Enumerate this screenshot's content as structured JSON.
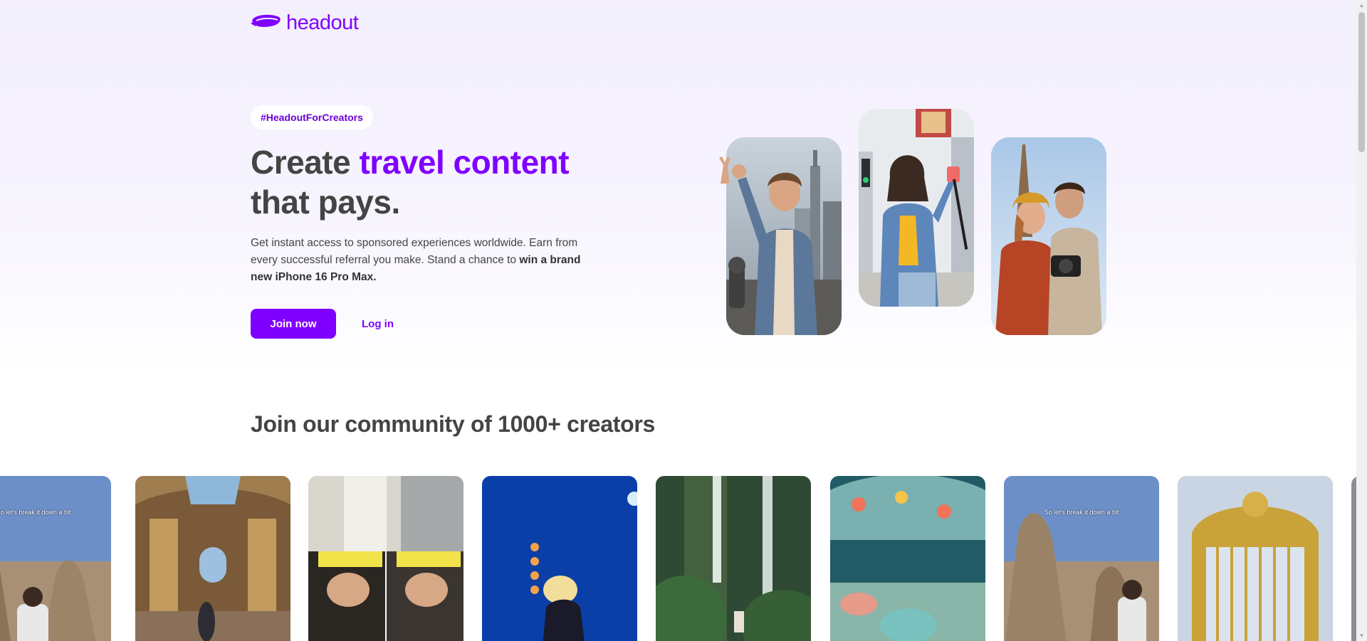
{
  "brand": {
    "name": "headout",
    "logo_icon": "headout-blimp-icon",
    "color": "#8000ff"
  },
  "hero": {
    "tag": "#HeadoutForCreators",
    "title_line1_plain": "Create ",
    "title_line1_accent": "travel content",
    "title_line2": "that pays.",
    "description_plain": "Get instant access to sponsored experiences worldwide. Earn from every successful referral you make. Stand a chance to ",
    "description_bold": "win a brand new iPhone 16 Pro Max.",
    "join_label": "Join now",
    "login_label": "Log in"
  },
  "community": {
    "title": "Join our community of 1000+ creators",
    "reels": [
      {
        "caption": "So let's break it down a bit",
        "scene": "cappadocia-rocks"
      },
      {
        "caption": "",
        "scene": "palace-hall"
      },
      {
        "caption": "",
        "scene": "skydive-split"
      },
      {
        "caption": "",
        "scene": "concert-stage"
      },
      {
        "caption": "",
        "scene": "jungle-waterfall"
      },
      {
        "caption": "",
        "scene": "teacup-ride"
      },
      {
        "caption": "So let's break it down a bit",
        "scene": "cappadocia-rocks"
      },
      {
        "caption": "",
        "scene": "golden-gate"
      }
    ]
  },
  "colors": {
    "accent": "#8000ff",
    "text": "#444444",
    "hero_bg": "#f3effd"
  }
}
